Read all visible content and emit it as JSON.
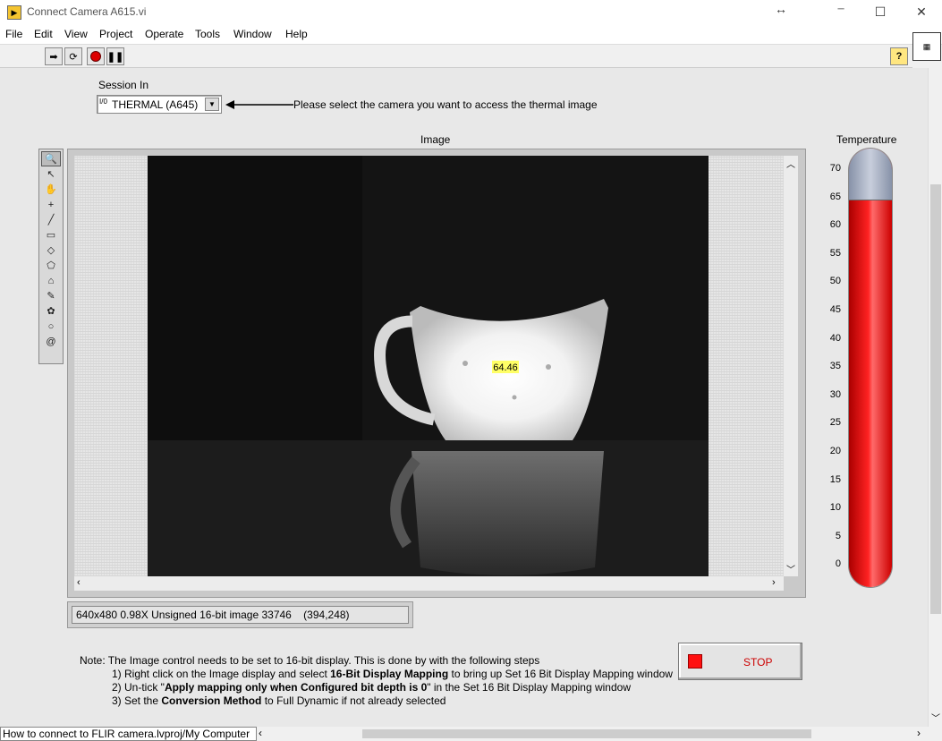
{
  "window": {
    "title": "Connect Camera A615.vi",
    "resize_glyph": "↔",
    "minimize": "─",
    "maximize": "☐",
    "close": "✕"
  },
  "menu": [
    "File",
    "Edit",
    "View",
    "Project",
    "Operate",
    "Tools",
    "Window",
    "Help"
  ],
  "toolbar": {
    "run_icon": "run-arrow-icon",
    "run_continuous_icon": "run-continuously-icon",
    "abort_icon": "abort-icon",
    "pause_icon": "pause-icon",
    "help_label": "?"
  },
  "session": {
    "label": "Session In",
    "value": "THERMAL (A645)",
    "io_glyph": "I/0",
    "hint": "Please select the camera you want to access the thermal image"
  },
  "image": {
    "label": "Image",
    "overlay_value": "64.46",
    "info": "640x480 0.98X Unsigned 16-bit image 33746    (394,248)"
  },
  "tools": [
    "zoom-icon",
    "pointer-icon",
    "pan-icon",
    "crosshair-icon",
    "line-icon",
    "rectangle-icon",
    "rotated-rect-icon",
    "polygon-icon",
    "freehand-icon",
    "closed-freehand-icon",
    "annulus-icon",
    "oval-icon",
    "spiral-icon"
  ],
  "thermometer": {
    "label": "Temperature",
    "ticks": [
      "70",
      "65",
      "60",
      "55",
      "50",
      "45",
      "40",
      "35",
      "30",
      "25",
      "20",
      "15",
      "10",
      "5",
      "0"
    ],
    "value": 64.46,
    "min": 0,
    "max": 70
  },
  "stop": {
    "label": "STOP"
  },
  "note": {
    "line0": "Note: The Image control needs to be set to 16-bit display. This is done by with the following steps",
    "line1a": "1) Right click on the Image display and select ",
    "line1b": "16-Bit Display Mapping",
    "line1c": " to bring up Set 16 Bit Display Mapping window",
    "line2a": "2) Un-tick \"",
    "line2b": "Apply mapping only when Configured bit depth is 0",
    "line2c": "\" in the Set 16 Bit Display Mapping window",
    "line3a": "3) Set the ",
    "line3b": "Conversion Method",
    "line3c": " to Full Dynamic if not already selected"
  },
  "status": {
    "path": "How to connect to FLIR camera.lvproj/My Computer"
  }
}
